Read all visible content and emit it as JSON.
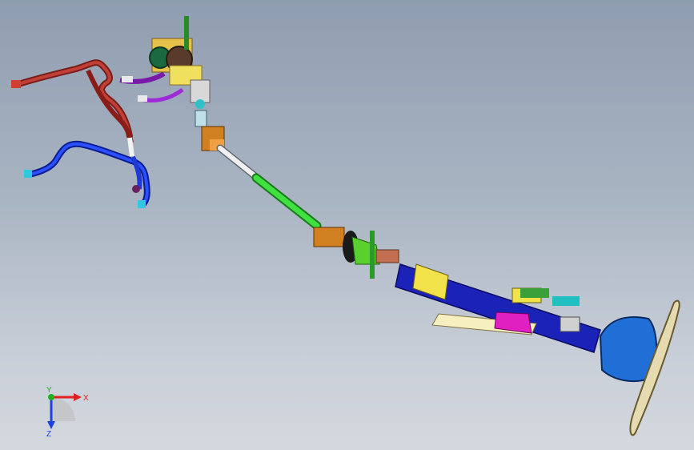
{
  "viewport": {
    "background_top": "#8f9db0",
    "background_bottom": "#d4d8de"
  },
  "triad": {
    "x_label": "X",
    "y_label": "Y",
    "z_label": "Z",
    "x_color": "#e02020",
    "y_color": "#20b020",
    "z_color": "#2040e0"
  },
  "parts": {
    "steering_wheel": "steering-wheel",
    "column_housing": "steering-column-housing",
    "intermediate_shaft": "intermediate-shaft",
    "lower_shaft": "lower-shaft",
    "gearbox": "steering-gear",
    "hoses": [
      "hose-red",
      "hose-blue",
      "hose-purple"
    ]
  },
  "colors": {
    "wheel_rim": "#e3d7a8",
    "wheel_hub": "#1f6fd6",
    "column": "#1b26c4",
    "shaft_green": "#33dd33",
    "shaft_white": "#f0f0f0",
    "hose_red": "#b0302a",
    "hose_blue": "#1030e0",
    "hose_purple": "#9a2ad0",
    "bracket_yellow": "#f2e24a",
    "bracket_magenta": "#e020c0"
  }
}
